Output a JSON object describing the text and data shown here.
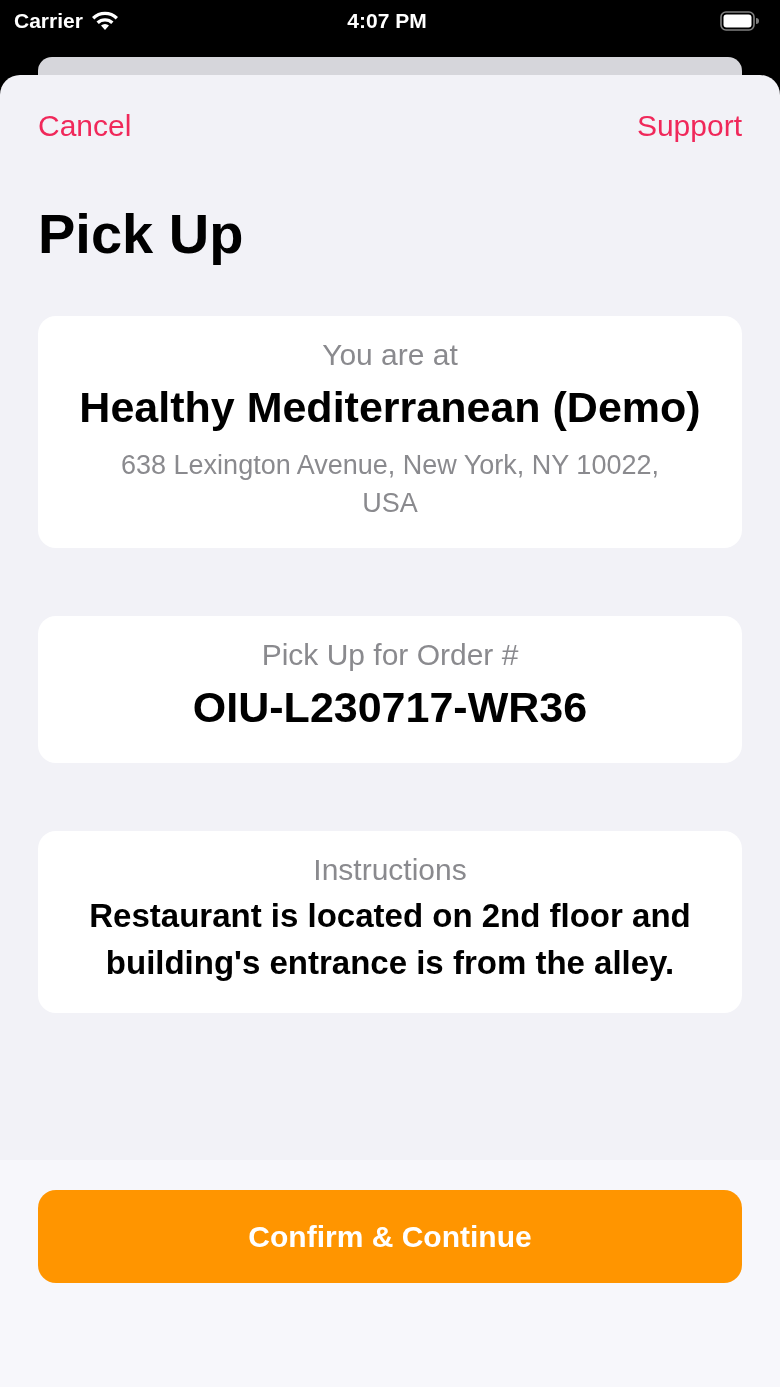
{
  "status_bar": {
    "carrier": "Carrier",
    "time": "4:07 PM"
  },
  "nav": {
    "cancel": "Cancel",
    "support": "Support"
  },
  "title": "Pick Up",
  "cards": [
    {
      "label": "You are at",
      "value": "Healthy Mediterranean (Demo)",
      "detail": "638 Lexington Avenue, New York, NY 10022, USA"
    },
    {
      "label": "Pick Up for Order #",
      "value": "OIU-L230717-WR36"
    },
    {
      "label": "Instructions",
      "value": "Restaurant is located on 2nd floor and building's entrance is from the alley."
    }
  ],
  "primary_button": "Confirm & Continue"
}
